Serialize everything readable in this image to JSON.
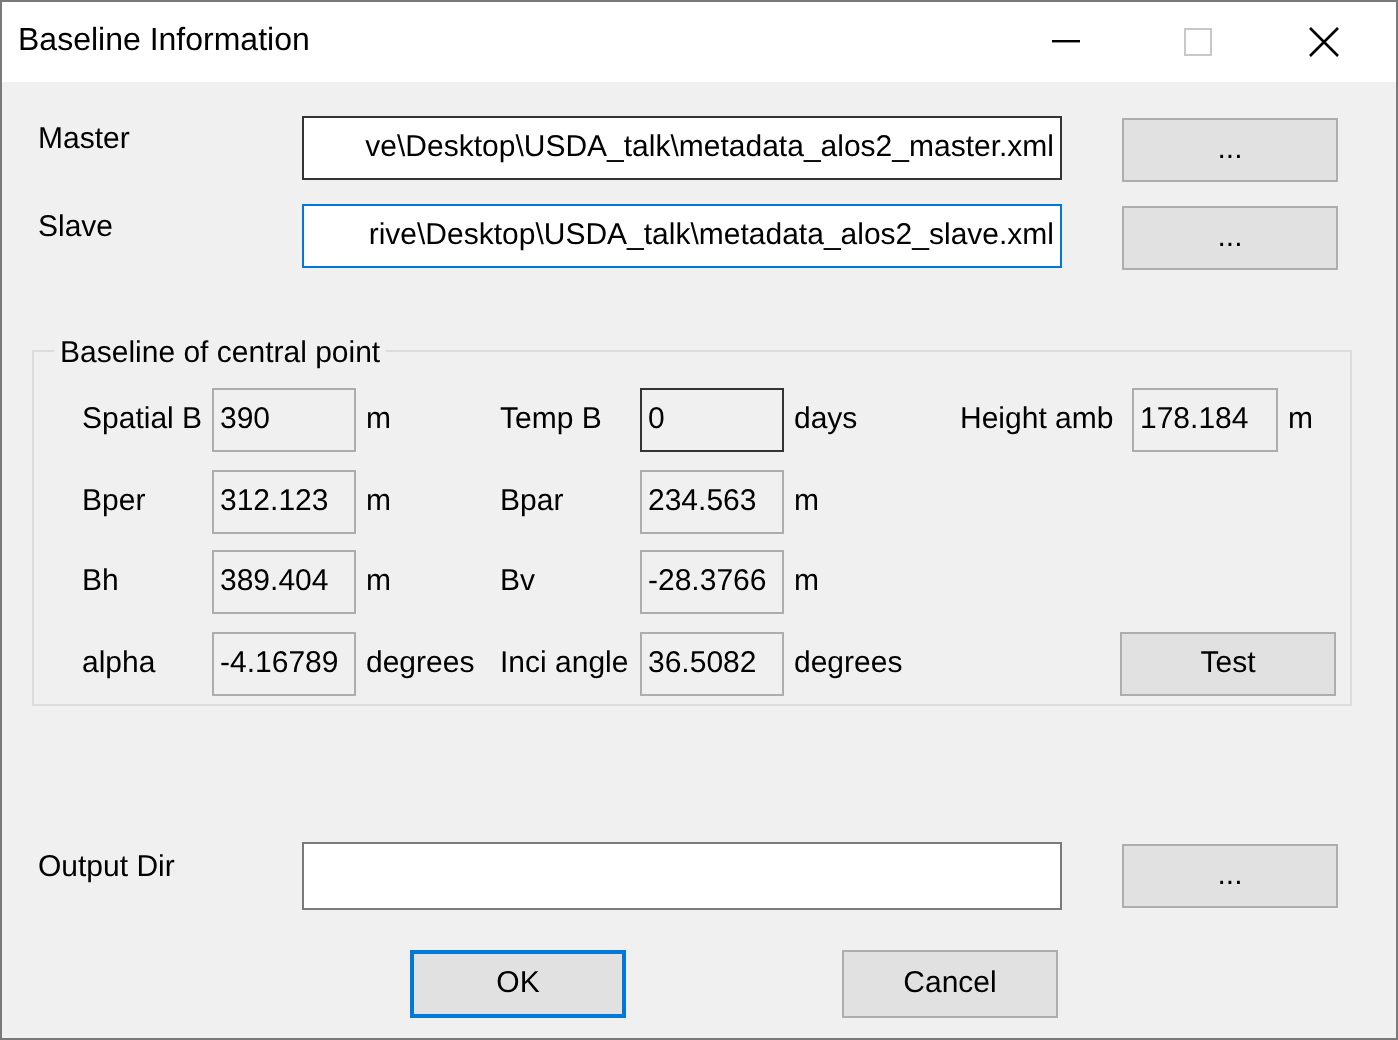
{
  "window": {
    "title": "Baseline Information"
  },
  "files": [
    {
      "label": "Master",
      "value": "ve\\Desktop\\USDA_talk\\metadata_alos2_master.xml",
      "focused": false,
      "button": "..."
    },
    {
      "label": "Slave",
      "value": "rive\\Desktop\\USDA_talk\\metadata_alos2_slave.xml",
      "focused": true,
      "button": "..."
    }
  ],
  "group": {
    "title": "Baseline of central point",
    "rows": [
      [
        {
          "label": "Spatial B",
          "value": "390",
          "unit": "m",
          "active": false
        },
        {
          "label": "Temp B",
          "value": "0",
          "unit": "days",
          "active": true
        },
        {
          "label": "Height amb",
          "value": "178.184",
          "unit": "m",
          "active": false
        }
      ],
      [
        {
          "label": "Bper",
          "value": "312.123",
          "unit": "m",
          "active": false
        },
        {
          "label": "Bpar",
          "value": "234.563",
          "unit": "m",
          "active": false
        }
      ],
      [
        {
          "label": "Bh",
          "value": "389.404",
          "unit": "m",
          "active": false
        },
        {
          "label": "Bv",
          "value": "-28.3766",
          "unit": "m",
          "active": false
        }
      ],
      [
        {
          "label": "alpha",
          "value": "-4.16789",
          "unit": "degrees",
          "active": false
        },
        {
          "label": "Inci angle",
          "value": "36.5082",
          "unit": "degrees",
          "active": false
        }
      ]
    ],
    "test_button": "Test"
  },
  "output": {
    "label": "Output Dir",
    "button": "..."
  },
  "buttons": [
    {
      "label": "OK",
      "default": true
    },
    {
      "label": "Cancel",
      "default": false
    }
  ]
}
